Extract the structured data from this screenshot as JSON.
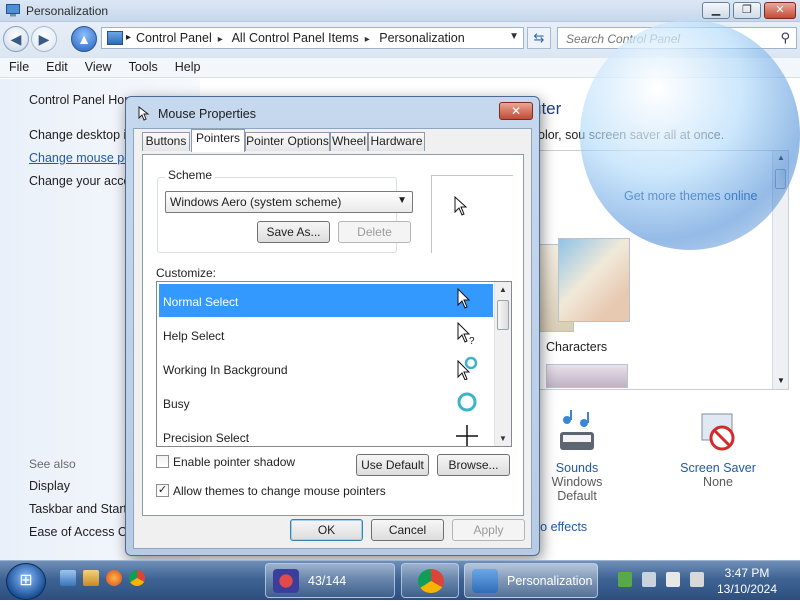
{
  "window": {
    "title": "Personalization",
    "buttons": {
      "minimize": "▁",
      "maximize": "❐",
      "close": "✕"
    }
  },
  "navigation": {
    "back_icon": "back-arrow-icon",
    "forward_icon": "forward-arrow-icon",
    "up_icon": "up-arrow-icon",
    "breadcrumbs": [
      "Control Panel",
      "All Control Panel Items",
      "Personalization"
    ],
    "search_placeholder": "Search Control Panel"
  },
  "menu": [
    "File",
    "Edit",
    "View",
    "Tools",
    "Help"
  ],
  "left_pane": {
    "home": "Control Panel Home",
    "links": [
      "Change desktop icons",
      "Change mouse pointers",
      "Change your account picture"
    ],
    "see_also_header": "See also",
    "see_also": [
      "Display",
      "Taskbar and Start Menu",
      "Ease of Access Center"
    ]
  },
  "main": {
    "heading": "uter",
    "description": "olor, sou       screen saver all at once.",
    "get_more": "Get more themes online",
    "theme_name": "Characters",
    "bottom": [
      {
        "label": "Sounds",
        "sub": "Windows Default"
      },
      {
        "label": "Screen Saver",
        "sub": "None"
      }
    ],
    "transparency_link": "ro effects"
  },
  "dialog": {
    "title": "Mouse Properties",
    "close": "✕",
    "tabs": [
      "Buttons",
      "Pointers",
      "Pointer Options",
      "Wheel",
      "Hardware"
    ],
    "active_tab": "Pointers",
    "scheme_label": "Scheme",
    "scheme_value": "Windows Aero (system scheme)",
    "save_as": "Save As...",
    "delete": "Delete",
    "customize_label": "Customize:",
    "pointers": [
      {
        "name": "Normal Select",
        "icon": "arrow-cursor-icon",
        "selected": true
      },
      {
        "name": "Help Select",
        "icon": "help-cursor-icon",
        "selected": false
      },
      {
        "name": "Working In Background",
        "icon": "working-cursor-icon",
        "selected": false
      },
      {
        "name": "Busy",
        "icon": "busy-cursor-icon",
        "selected": false
      },
      {
        "name": "Precision Select",
        "icon": "crosshair-cursor-icon",
        "selected": false
      }
    ],
    "enable_shadow": "Enable pointer shadow",
    "enable_shadow_checked": false,
    "allow_themes": "Allow themes to change mouse pointers",
    "allow_themes_checked": true,
    "use_default": "Use Default",
    "browse": "Browse...",
    "ok": "OK",
    "cancel": "Cancel",
    "apply": "Apply"
  },
  "taskbar": {
    "items": [
      {
        "label": "43/144",
        "icon": "screen-recorder-icon"
      },
      {
        "label": "",
        "icon": "chrome-icon"
      },
      {
        "label": "Personalization",
        "icon": "control-panel-icon"
      }
    ],
    "time": "3:47 PM",
    "date": "13/10/2024"
  },
  "colors": {
    "accent": "#3399ff",
    "link": "#1f5aa8",
    "taskbar": "#3f6494"
  }
}
